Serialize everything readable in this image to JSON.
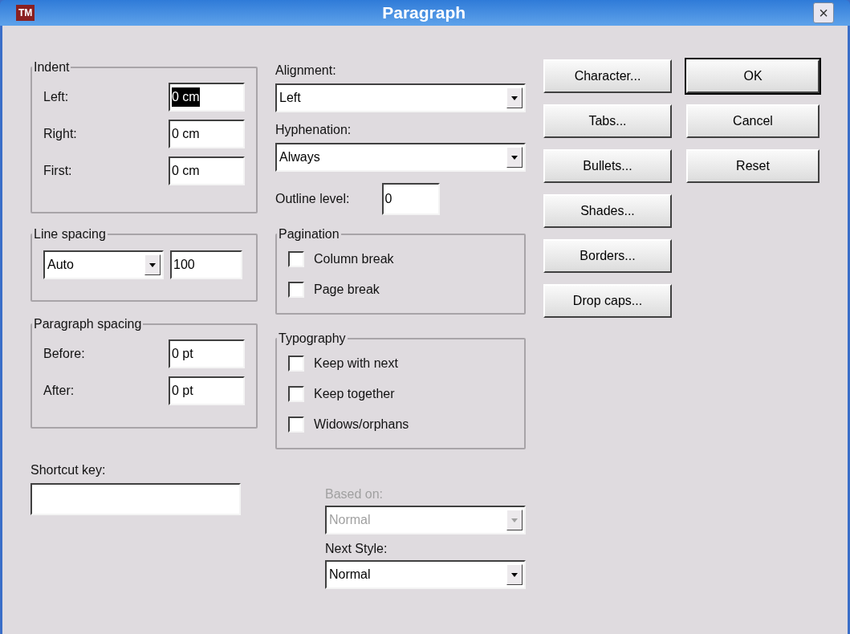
{
  "window": {
    "title": "Paragraph",
    "logo": "TM",
    "close": "×"
  },
  "indent": {
    "title": "Indent",
    "fields": [
      {
        "label": "Left:",
        "value": "0 cm",
        "selected": true
      },
      {
        "label": "Right:",
        "value": "0 cm",
        "selected": false
      },
      {
        "label": "First:",
        "value": "0 cm",
        "selected": false
      }
    ]
  },
  "line_spacing": {
    "title": "Line spacing",
    "mode": "Auto",
    "value": "100"
  },
  "paragraph_spacing": {
    "title": "Paragraph spacing",
    "fields": [
      {
        "label": "Before:",
        "value": "0 pt",
        "selected": false
      },
      {
        "label": "After:",
        "value": "0 pt",
        "selected": false
      }
    ]
  },
  "shortcut_key": {
    "label": "Shortcut key:"
  },
  "alignment": {
    "label": "Alignment:",
    "value": "Left"
  },
  "hyphenation": {
    "label": "Hyphenation:",
    "value": "Always"
  },
  "outline_level": {
    "label": "Outline level:",
    "value": "0"
  },
  "pagination": {
    "title": "Pagination",
    "options": [
      {
        "label": "Column break",
        "checked": false
      },
      {
        "label": "Page break",
        "checked": false
      }
    ]
  },
  "typography": {
    "title": "Typography",
    "options": [
      {
        "label": "Keep with next",
        "checked": false
      },
      {
        "label": "Keep together",
        "checked": false
      },
      {
        "label": "Widows/orphans",
        "checked": false
      }
    ]
  },
  "based_on": {
    "label": "Based on:",
    "value": "Normal",
    "disabled": true
  },
  "next_style": {
    "label": "Next Style:",
    "value": "Normal",
    "disabled": false
  },
  "side_buttons": [
    {
      "label": "Character..."
    },
    {
      "label": "Tabs..."
    },
    {
      "label": "Bullets..."
    },
    {
      "label": "Shades..."
    },
    {
      "label": "Borders..."
    },
    {
      "label": "Drop caps..."
    }
  ],
  "action_buttons": [
    {
      "label": "OK",
      "default": true
    },
    {
      "label": "Cancel",
      "default": false
    },
    {
      "label": "Reset",
      "default": false
    }
  ]
}
